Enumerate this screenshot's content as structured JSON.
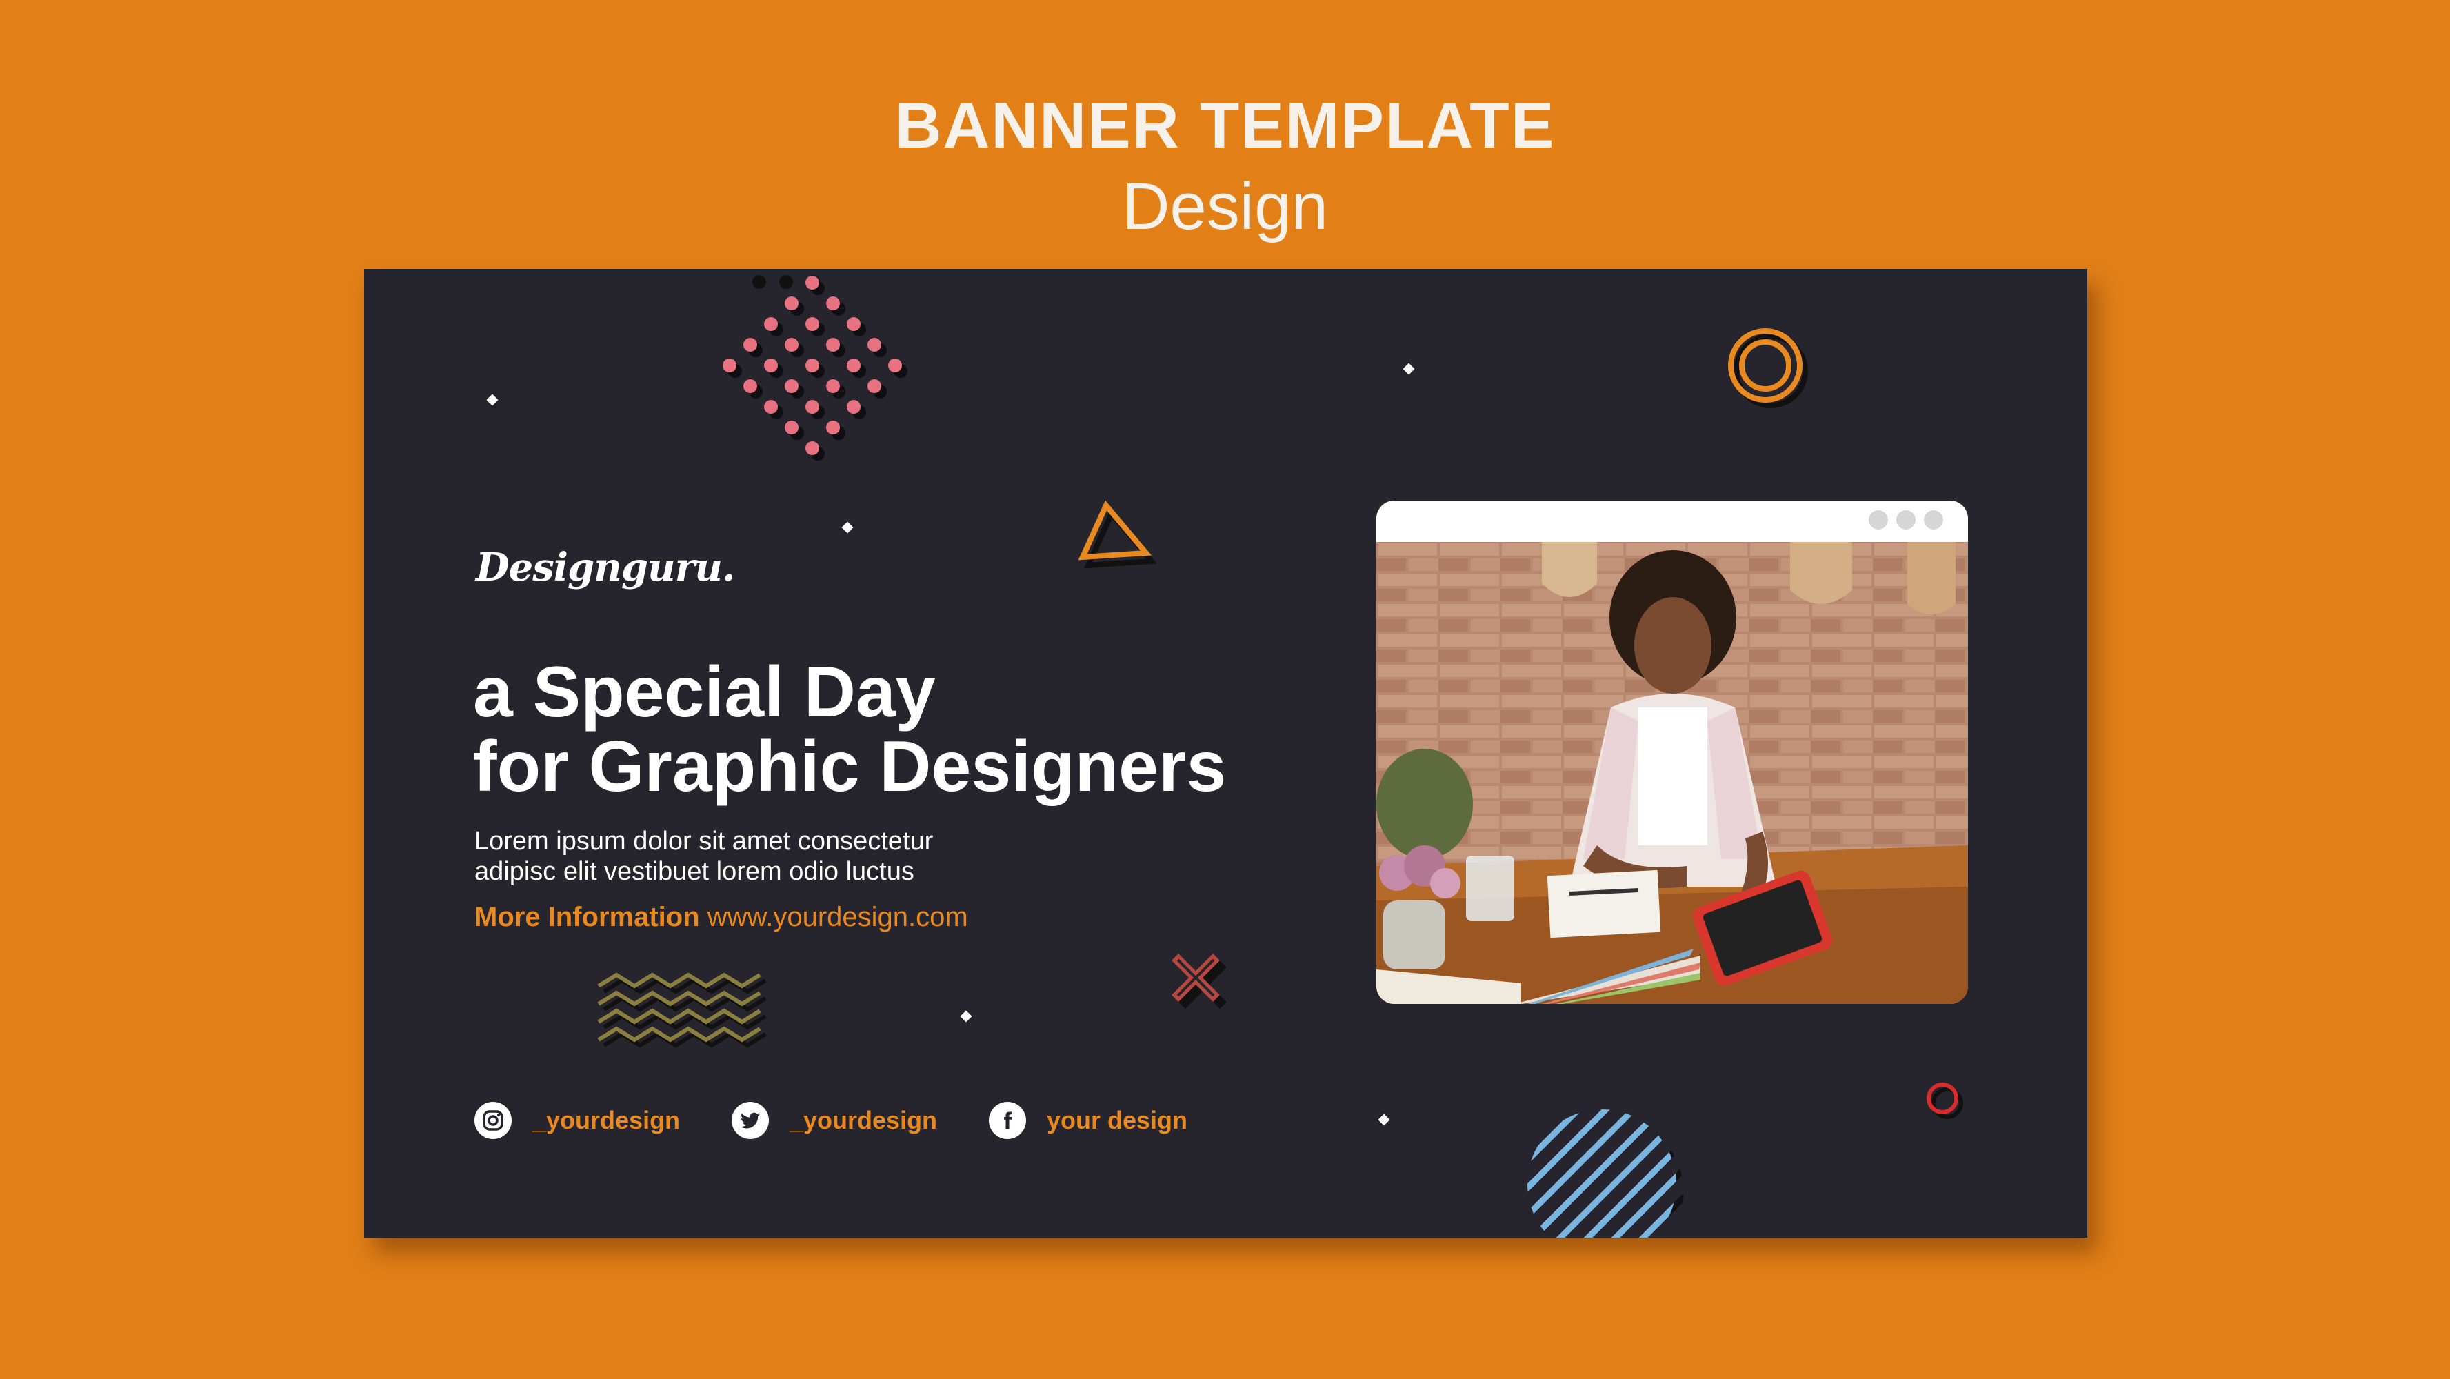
{
  "header": {
    "title": "BANNER TEMPLATE",
    "subtitle": "Design"
  },
  "banner": {
    "brand": "Designguru.",
    "headline_line1": "a Special Day",
    "headline_line2": "for Graphic Designers",
    "body_line1": "Lorem ipsum dolor sit amet consectetur",
    "body_line2": "adipisc elit vestibuet lorem odio luctus",
    "more_label": "More Information",
    "more_url": "www.yourdesign.com",
    "social": [
      {
        "icon": "instagram-icon",
        "label": "_yourdesign"
      },
      {
        "icon": "twitter-icon",
        "label": "_yourdesign"
      },
      {
        "icon": "facebook-icon",
        "label": "your design"
      }
    ]
  },
  "colors": {
    "background": "#E27F17",
    "banner": "#26242D",
    "accent": "#E88A1F",
    "text": "#FFFFFF"
  }
}
